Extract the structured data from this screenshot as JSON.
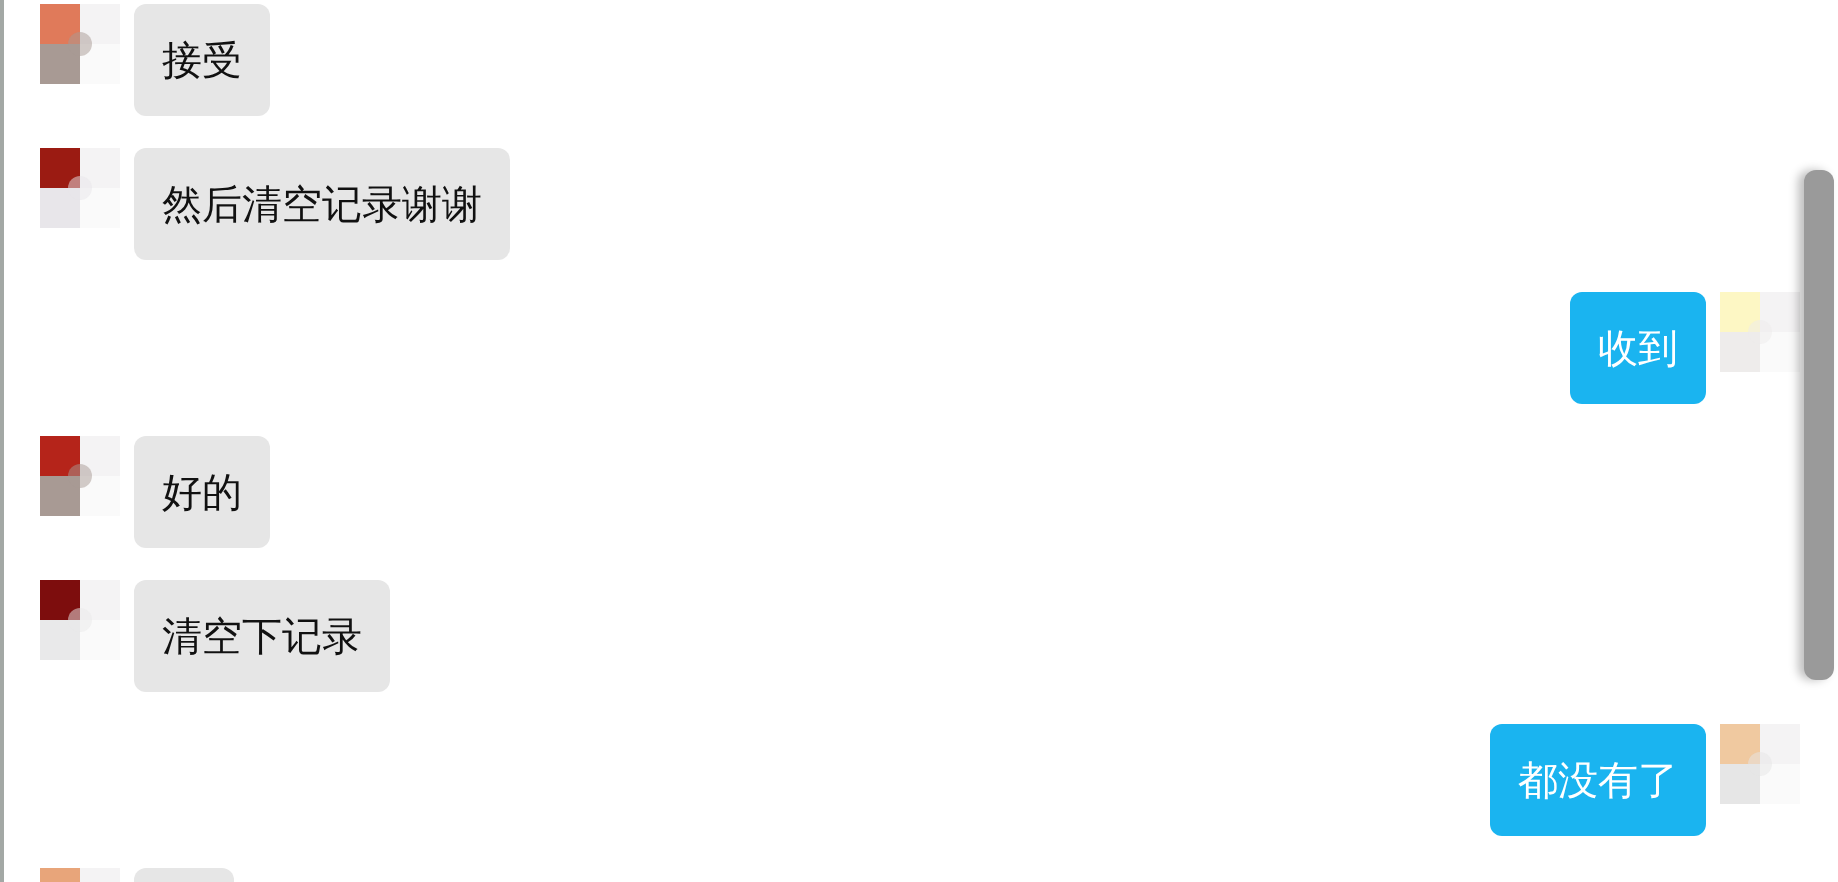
{
  "messages": [
    {
      "kind": "incoming",
      "text": "接受"
    },
    {
      "kind": "incoming",
      "text": "然后清空记录谢谢"
    },
    {
      "kind": "outgoing",
      "text": "收到"
    },
    {
      "kind": "incoming",
      "text": "好的"
    },
    {
      "kind": "incoming",
      "text": "清空下记录"
    },
    {
      "kind": "outgoing",
      "text": "都没有了"
    },
    {
      "kind": "incoming"
    }
  ]
}
